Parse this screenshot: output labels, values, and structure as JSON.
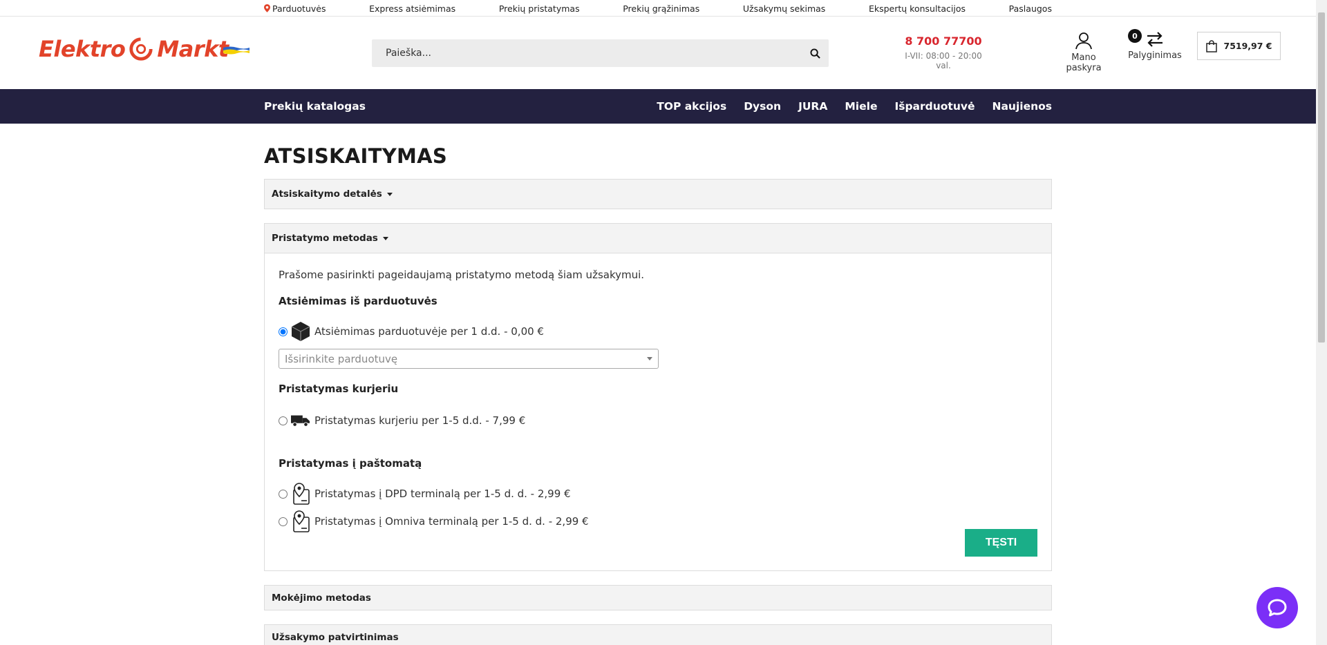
{
  "topbar": {
    "links": [
      "Parduotuvės",
      "Express atsiėmimas",
      "Prekių pristatymas",
      "Prekių grąžinimas",
      "Užsakymų sekimas",
      "Ekspertų konsultacijos",
      "Paslaugos"
    ]
  },
  "header": {
    "logo_left": "Elektro",
    "logo_right": "Markt",
    "search_placeholder": "Paieška...",
    "phone": "8 700 77700",
    "hours": "I-VII: 08:00 - 20:00 val.",
    "account_label": "Mano paskyra",
    "compare_count": "0",
    "compare_label": "Palyginimas",
    "cart_total": "7519,97 €"
  },
  "nav": {
    "catalog": "Prekių katalogas",
    "links": [
      "TOP akcijos",
      "Dyson",
      "JURA",
      "Miele",
      "Išparduotuvė",
      "Naujienos"
    ]
  },
  "checkout": {
    "title": "ATSISKAITYMAS",
    "sections": [
      {
        "label": "Atsiskaitymo detalės"
      },
      {
        "label": "Pristatymo metodas"
      },
      {
        "label": "Mokėjimo metodas"
      },
      {
        "label": "Užsakymo patvirtinimas"
      }
    ],
    "delivery": {
      "intro": "Prašome pasirinkti pageidaujamą pristatymo metodą šiam užsakymui.",
      "store_pickup_title": "Atsiėmimas iš parduotuvės",
      "store_pickup_option": "Atsiėmimas parduotuvėje per 1 d.d. - 0,00 €",
      "store_select_placeholder": "Išsirinkite parduotuvę",
      "courier_title": "Pristatymas kurjeriu",
      "courier_option": "Pristatymas kurjeriu per 1-5 d.d. - 7,99 €",
      "parcel_title": "Pristatymas į paštomatą",
      "dpd_option": "Pristatymas į DPD terminalą per 1-5 d. d. - 2,99 €",
      "omniva_option": "Pristatymas į Omniva terminalą per 1-5 d. d. - 2,99 €",
      "continue_label": "TĘSTI",
      "selected": "store_pickup"
    }
  },
  "colors": {
    "brand_red": "#e2432a",
    "nav_bg": "#232140",
    "continue_green": "#1aae88",
    "chat_purple": "#7b2ff7"
  }
}
